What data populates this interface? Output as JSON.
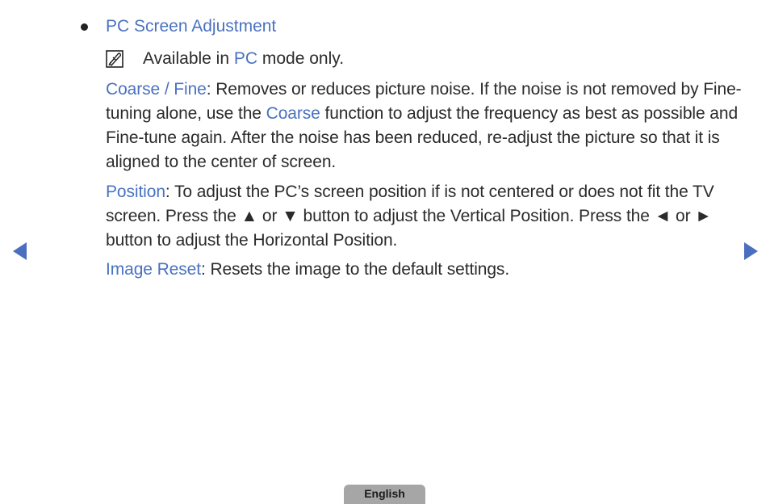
{
  "section": {
    "title": "PC Screen Adjustment",
    "bullet_icon": "bullet-dot"
  },
  "note": {
    "icon": "note-pencil-icon",
    "prefix": "Available in ",
    "highlight": "PC",
    "suffix": " mode only."
  },
  "items": [
    {
      "term": "Coarse / Fine",
      "text_1": ": Removes or reduces picture noise. If the noise is not removed by Fine-tuning alone, use the ",
      "term_2": "Coarse",
      "text_2": " function to adjust the frequency as best as possible and Fine-tune again. After the noise has been reduced, re-adjust the picture so that it is aligned to the center of screen."
    },
    {
      "term": "Position",
      "text_1": ": To adjust the PC’s screen position if is not centered or does not fit the TV screen. Press the ▲ or ▼ button to adjust the Vertical Position. Press the ◄ or ► button to adjust the Horizontal Position."
    },
    {
      "term": "Image Reset",
      "text_1": ": Resets the image to the default settings."
    }
  ],
  "navigation": {
    "prev_icon": "triangle-left-icon",
    "next_icon": "triangle-right-icon"
  },
  "footer": {
    "language_label": "English"
  },
  "colors": {
    "accent": "#4a72c0",
    "nav_arrow": "#4a6fbf",
    "language_tab": "#a6a6a6",
    "text": "#2b2b2b"
  }
}
